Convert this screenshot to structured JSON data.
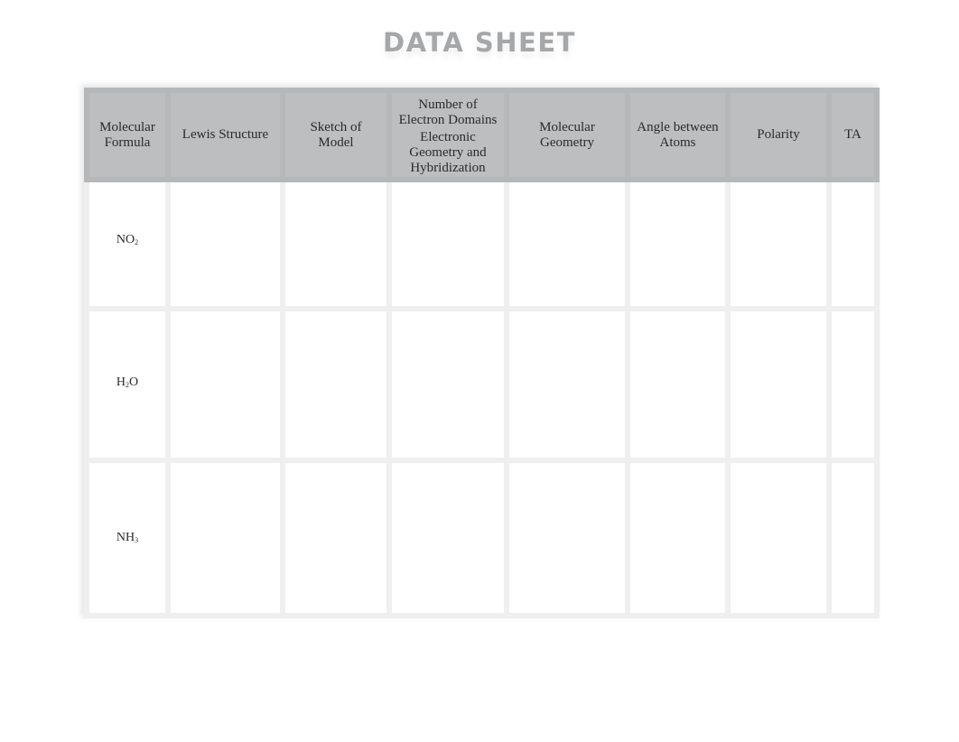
{
  "title": "DATA SHEET",
  "table": {
    "headers": [
      "Molecular Formula",
      "Lewis Structure",
      "Sketch of Model",
      "Number of Electron Domains Electronic Geometry and Hybridization",
      "Molecular Geometry",
      "Angle between Atoms",
      "Polarity",
      "TA"
    ],
    "header_lines": {
      "col0": [
        "Molecular",
        "Formula"
      ],
      "col1": [
        "Lewis Structure"
      ],
      "col2": [
        "Sketch of",
        "Model"
      ],
      "col3": [
        "Number of",
        "Electron Domains",
        "Electronic",
        "Geometry and",
        "Hybridization"
      ],
      "col4": [
        "Molecular",
        "Geometry"
      ],
      "col5": [
        "Angle between",
        "Atoms"
      ],
      "col6": [
        "Polarity"
      ],
      "col7": [
        "TA"
      ]
    },
    "rows": [
      {
        "formula_base": "NO",
        "formula_sub": "2",
        "formula_tail": ""
      },
      {
        "formula_base": "H",
        "formula_sub": "2",
        "formula_tail": "O"
      },
      {
        "formula_base": "NH",
        "formula_sub": "3",
        "formula_tail": ""
      }
    ]
  },
  "colors": {
    "header_bg": "#bcbec0",
    "title": "#a6a7a9",
    "grid": "#efefef"
  }
}
